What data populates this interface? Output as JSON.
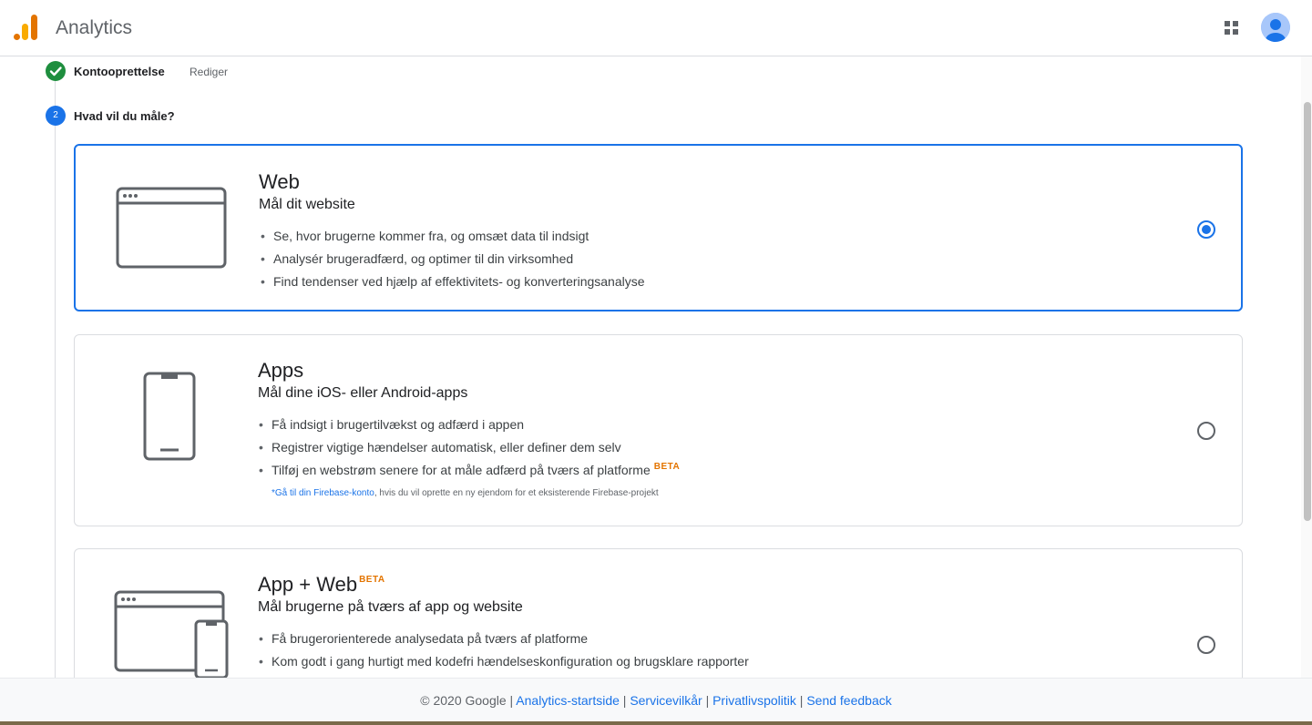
{
  "header": {
    "app_title": "Analytics",
    "logo_icon": "analytics-logo-icon",
    "apps_icon": "apps-grid-icon",
    "avatar_icon": "account-avatar-icon",
    "colors": {
      "logo_dark": "#e37400",
      "logo_light": "#f9ab00"
    }
  },
  "stepper": {
    "step1": {
      "label": "Kontooprettelse",
      "edit": "Rediger",
      "status": "complete",
      "color": "#1e8e3e"
    },
    "step2": {
      "number": "2",
      "label": "Hvad vil du måle?",
      "color": "#1a73e8"
    }
  },
  "cards": [
    {
      "title": "Web",
      "subtitle": "Mål dit website",
      "bullets": [
        "Se, hvor brugerne kommer fra, og omsæt data til indsigt",
        "Analysér brugeradfærd, og optimer til din virksomhed",
        "Find tendenser ved hjælp af effektivitets- og konverteringsanalyse"
      ],
      "selected": true,
      "icon": "browser-window-icon"
    },
    {
      "title": "Apps",
      "subtitle": "Mål dine iOS- eller Android-apps",
      "bullets": [
        "Få indsigt i brugertilvækst og adfærd i appen",
        "Registrer vigtige hændelser automatisk, eller definer dem selv",
        "Tilføj en webstrøm senere for at måle adfærd på tværs af platforme"
      ],
      "bullet_badge": "BETA",
      "note_link": "*Gå til din Firebase-konto",
      "note_text": ", hvis du vil oprette en ny ejendom for et eksisterende Firebase-projekt",
      "selected": false,
      "icon": "mobile-phone-icon"
    },
    {
      "title": "App + Web",
      "title_badge": "BETA",
      "subtitle": "Mål brugerne på tværs af app og website",
      "bullets": [
        "Få brugerorienterede analysedata på tværs af platforme",
        "Kom godt i gang hurtigt med kodefri hændelseskonfiguration og brugsklare rapporter"
      ],
      "selected": false,
      "icon": "browser-and-phone-icon"
    }
  ],
  "footer": {
    "copyright": "© 2020 Google",
    "links": [
      "Analytics-startside",
      "Servicevilkår",
      "Privatlivspolitik",
      "Send feedback"
    ],
    "separator": "|"
  },
  "colors": {
    "accent": "#1a73e8",
    "beta": "#e37400",
    "success": "#1e8e3e"
  }
}
